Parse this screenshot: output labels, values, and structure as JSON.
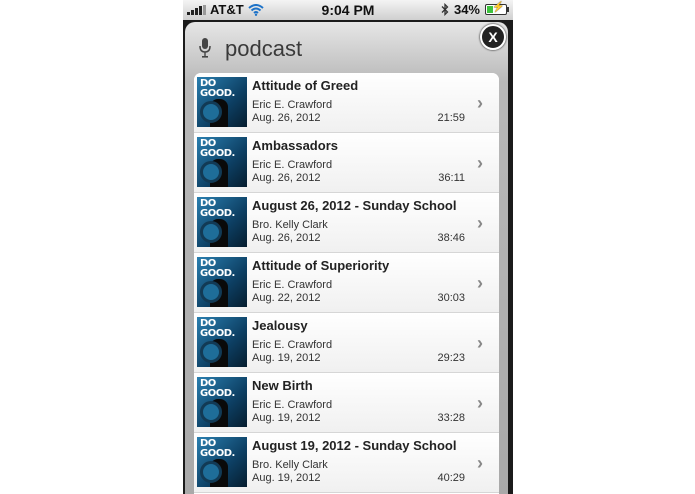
{
  "status_bar": {
    "carrier": "AT&T",
    "time": "9:04 PM",
    "battery": "34%",
    "battery_level": 0.34
  },
  "panel": {
    "title": "podcast",
    "close_label": "X"
  },
  "episodes": [
    {
      "title": "Attitude of Greed",
      "author": "Eric E. Crawford",
      "date": "Aug. 26, 2012",
      "duration": "21:59"
    },
    {
      "title": "Ambassadors",
      "author": "Eric E. Crawford",
      "date": "Aug. 26, 2012",
      "duration": "36:11"
    },
    {
      "title": "August 26, 2012 - Sunday School",
      "author": "Bro. Kelly Clark",
      "date": "Aug. 26, 2012",
      "duration": "38:46"
    },
    {
      "title": "Attitude of Superiority",
      "author": "Eric E. Crawford",
      "date": "Aug. 22, 2012",
      "duration": "30:03"
    },
    {
      "title": "Jealousy",
      "author": "Eric E. Crawford",
      "date": "Aug. 19, 2012",
      "duration": "29:23"
    },
    {
      "title": "New Birth",
      "author": "Eric E. Crawford",
      "date": "Aug. 19, 2012",
      "duration": "33:28"
    },
    {
      "title": "August 19, 2012 - Sunday School",
      "author": "Bro. Kelly Clark",
      "date": "Aug. 19, 2012",
      "duration": "40:29"
    }
  ],
  "thumbnail_logo": "DO GOOD.",
  "icons": {
    "signal": "signal-bars-icon",
    "wifi": "wifi-icon",
    "bluetooth": "bluetooth-icon",
    "battery": "battery-icon",
    "mic": "microphone-icon",
    "close": "close-icon",
    "chevron": "chevron-right-icon"
  }
}
